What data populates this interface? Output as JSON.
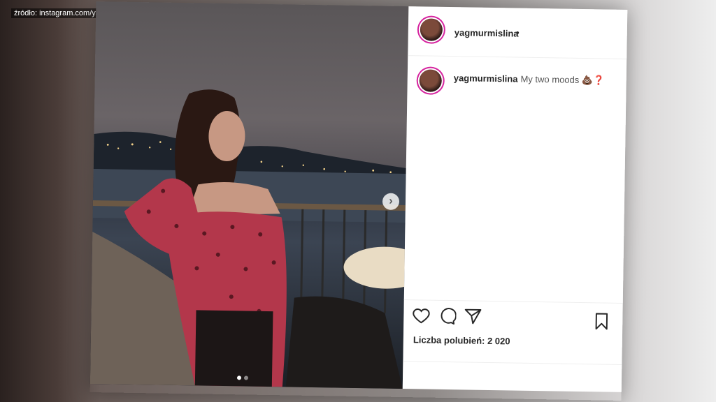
{
  "source_caption": "źródło: instagram.com/yagmurmislina",
  "post": {
    "header": {
      "username": "yagmurmislina",
      "dot": "•"
    },
    "caption": {
      "username": "yagmurmislina",
      "text": "My two moods 💩❓"
    },
    "likes_text": "Liczba polubień: 2 020",
    "carousel": {
      "count": 2,
      "active": 1
    },
    "icons": [
      "heart-icon",
      "comment-icon",
      "share-icon",
      "bookmark-icon",
      "chevron-right-icon"
    ]
  }
}
